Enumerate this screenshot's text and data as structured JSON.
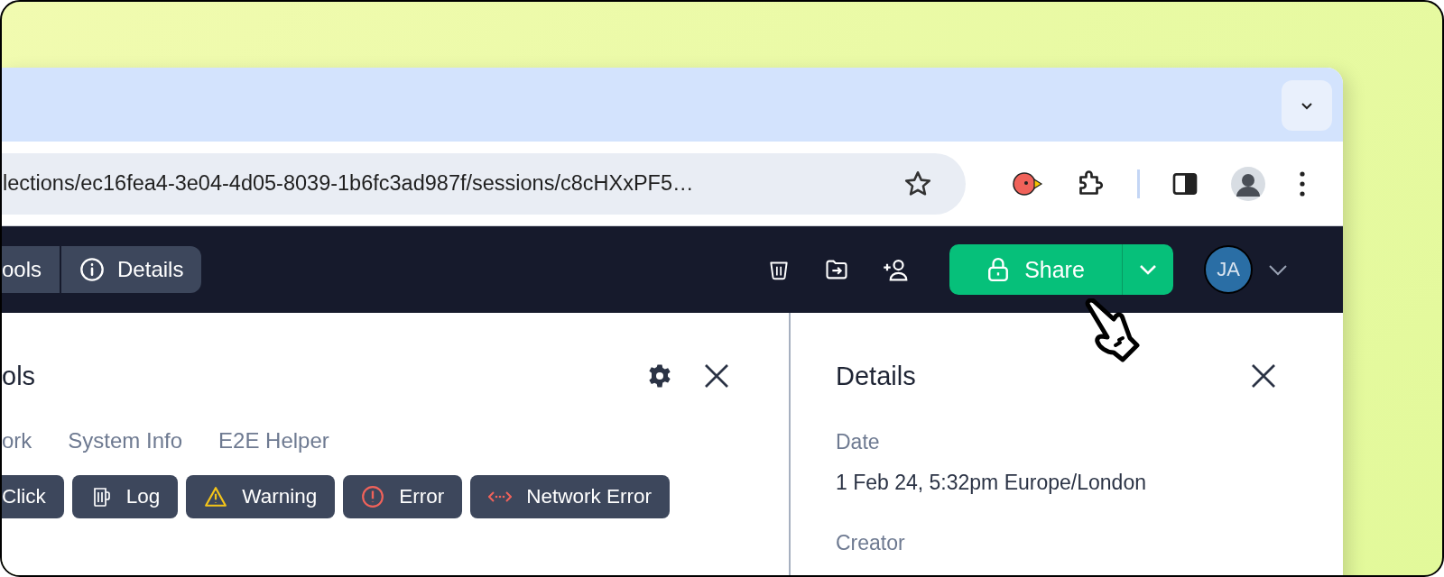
{
  "browser": {
    "url": "lections/ec16fea4-3e04-4d05-8039-1b6fc3ad987f/sessions/c8cHXxPF5…"
  },
  "header": {
    "panel_toggles": [
      {
        "label": "ools",
        "kind": "tools",
        "on": true
      },
      {
        "label": "Details",
        "kind": "info",
        "on": true
      }
    ],
    "share_button": {
      "label": "Share"
    },
    "avatar": {
      "initials": "JA"
    }
  },
  "devtools_panel": {
    "title": "ols",
    "tabs": [
      {
        "label": "ork",
        "selected": false
      },
      {
        "label": "System Info",
        "selected": false
      },
      {
        "label": "E2E Helper",
        "selected": false
      }
    ],
    "filters": [
      {
        "label": "Click",
        "kind": "click"
      },
      {
        "label": "Log",
        "kind": "log"
      },
      {
        "label": "Warning",
        "kind": "warning"
      },
      {
        "label": "Error",
        "kind": "error"
      },
      {
        "label": "Network Error",
        "kind": "network"
      }
    ]
  },
  "details_panel": {
    "title": "Details",
    "fields": [
      {
        "label": "Date",
        "value": "1 Feb 24, 5:32pm Europe/London"
      },
      {
        "label": "Creator"
      }
    ]
  }
}
